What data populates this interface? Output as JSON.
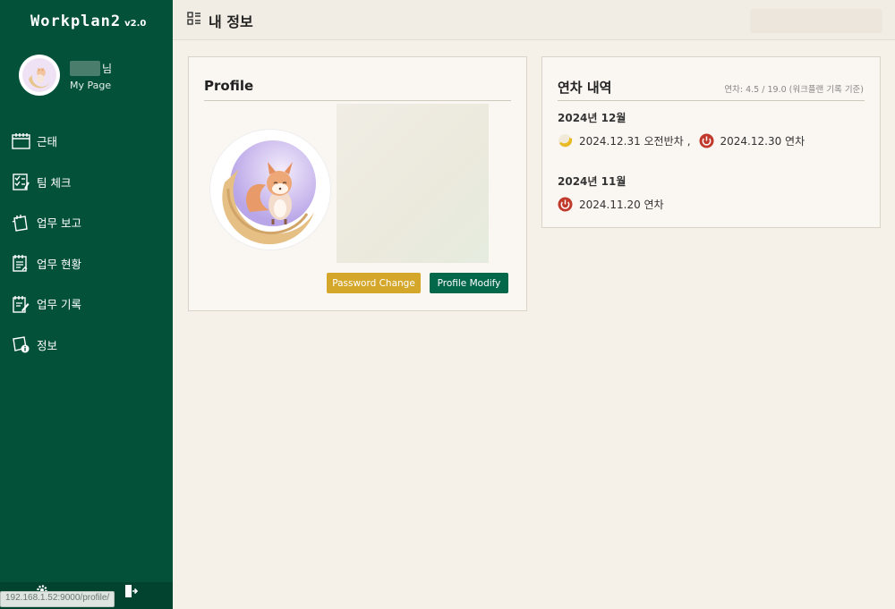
{
  "app": {
    "name": "Workplan2",
    "version": "v2.0"
  },
  "user": {
    "suffix": "님",
    "mypage_label": "My Page"
  },
  "sidebar": {
    "items": [
      {
        "label": "근태",
        "icon": "calendar-icon"
      },
      {
        "label": "팀 체크",
        "icon": "checklist-icon"
      },
      {
        "label": "업무 보고",
        "icon": "report-icon"
      },
      {
        "label": "업무 현황",
        "icon": "status-icon"
      },
      {
        "label": "업무 기록",
        "icon": "record-icon"
      },
      {
        "label": "정보",
        "icon": "info-icon"
      }
    ],
    "status_url": "192.168.1.52:9000/profile/"
  },
  "header": {
    "title": "내 정보"
  },
  "profile_card": {
    "title": "Profile",
    "password_button": "Password Change",
    "modify_button": "Profile Modify"
  },
  "leave_card": {
    "title": "연차 내역",
    "summary": "연차: 4.5 / 19.0 (워크플랜 기록 기준)",
    "months": [
      {
        "label": "2024년 12월",
        "entries": [
          {
            "text": "2024.12.31 오전반차",
            "type": "half-day",
            "sep": ","
          },
          {
            "text": "2024.12.30 연차",
            "type": "full-day"
          }
        ]
      },
      {
        "label": "2024년 11월",
        "entries": [
          {
            "text": "2024.11.20 연차",
            "type": "full-day"
          }
        ]
      }
    ]
  },
  "colors": {
    "sidebar": "#035139",
    "background": "#f5f0e8",
    "accent_green": "#03684a",
    "accent_yellow": "#d4a62a",
    "leave_red": "#c0392b",
    "half_day_yellow": "#e8b920"
  }
}
